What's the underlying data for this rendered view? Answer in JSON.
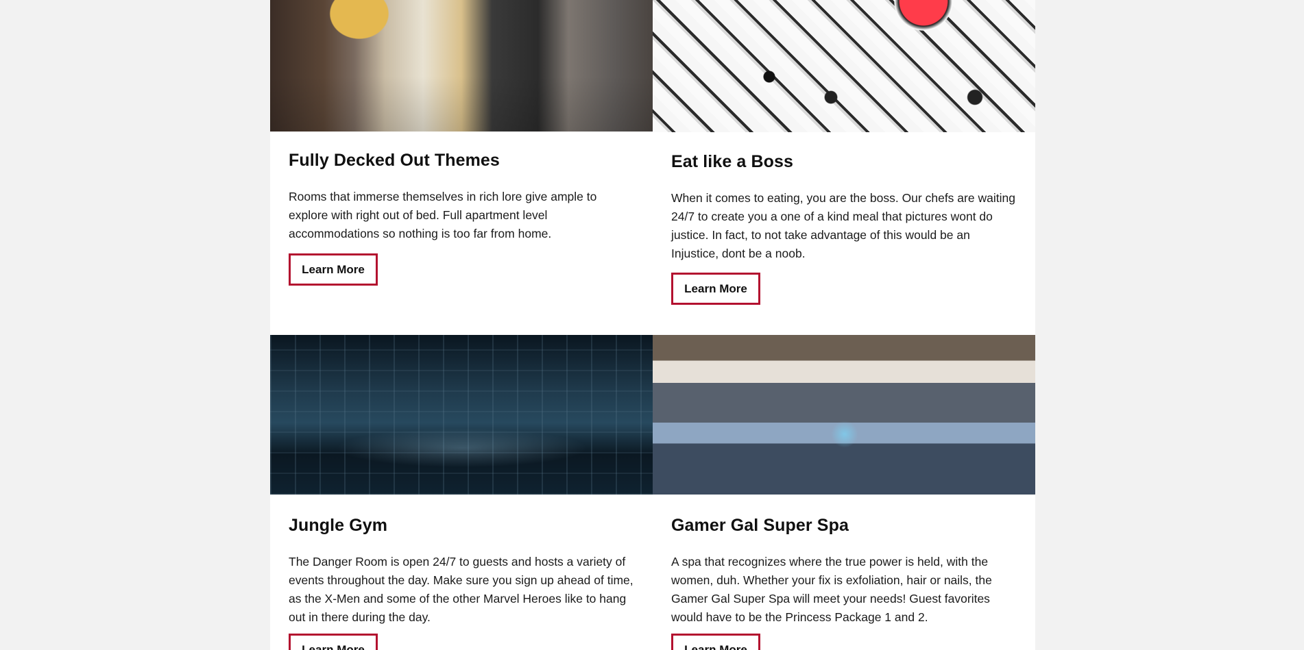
{
  "cards": [
    {
      "title": "Fully Decked Out Themes",
      "description": "Rooms that immerse themselves in rich lore give ample to explore with right out of bed. Full apartment level accommodations so nothing is too far from home.",
      "button_label": "Learn More",
      "image": "batman-themed-bedroom"
    },
    {
      "title": "Eat like a Boss",
      "description": "When it comes to eating, you are the boss. Our chefs are waiting 24/7 to create you a one of a kind meal that pictures wont do justice. In fact, to not take advantage of this would be an Injustice, dont be a noob.",
      "button_label": "Learn More",
      "image": "pokeball-cake"
    },
    {
      "title": "Jungle Gym",
      "description": "The Danger Room is open 24/7 to guests and hosts a variety of events throughout the day. Make sure you sign up ahead of time, as the X-Men and some of the other Marvel Heroes like to hang out in there during the day.",
      "button_label": "Learn More",
      "image": "danger-room"
    },
    {
      "title": "Gamer Gal Super Spa",
      "description": "A spa that recognizes where the true power is held, with the women, duh. Whether your fix is exfoliation, hair or nails, the Gamer Gal Super Spa will meet your needs! Guest favorites would have to be the Princess Package 1 and 2.",
      "button_label": "Learn More",
      "image": "spa-room"
    }
  ],
  "colors": {
    "page_background": "#f2f2f2",
    "card_background": "#ffffff",
    "button_border": "#b3112f",
    "text": "#111111"
  }
}
